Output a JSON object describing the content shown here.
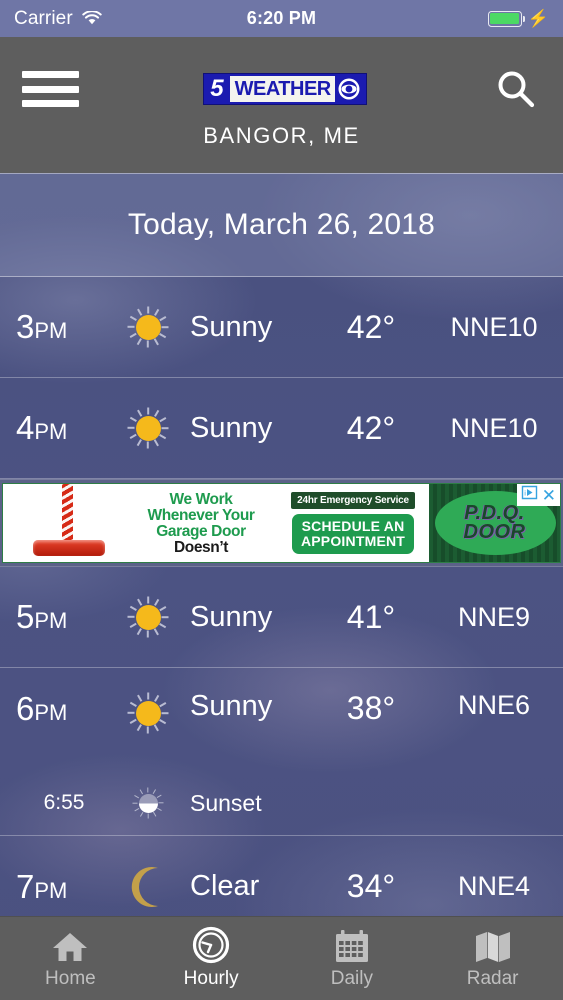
{
  "status_bar": {
    "carrier": "Carrier",
    "time": "6:20 PM",
    "wifi_icon": "wifi-icon",
    "battery_icon": "battery-full-icon",
    "charging_icon": "lightning-bolt-icon"
  },
  "header": {
    "menu_icon": "hamburger-menu-icon",
    "search_icon": "search-icon",
    "logo": {
      "channel": "5",
      "word": "WEATHER",
      "eye_icon": "cbs-eye-icon"
    },
    "city": "BANGOR, ME"
  },
  "date_banner": {
    "text": "Today, March 26, 2018"
  },
  "hourly": [
    {
      "hour": "3",
      "ampm": "PM",
      "icon": "sun-icon",
      "condition": "Sunny",
      "temp": "42°",
      "wind": "NNE10"
    },
    {
      "hour": "4",
      "ampm": "PM",
      "icon": "sun-icon",
      "condition": "Sunny",
      "temp": "42°",
      "wind": "NNE10"
    },
    {
      "hour": "5",
      "ampm": "PM",
      "icon": "sun-icon",
      "condition": "Sunny",
      "temp": "41°",
      "wind": "NNE9"
    },
    {
      "hour": "6",
      "ampm": "PM",
      "icon": "sun-icon",
      "condition": "Sunny",
      "temp": "38°",
      "wind": "NNE6",
      "sub": {
        "time": "6:55",
        "icon": "sunset-icon",
        "label": "Sunset"
      }
    },
    {
      "hour": "7",
      "ampm": "PM",
      "icon": "moon-icon",
      "condition": "Clear",
      "temp": "34°",
      "wind": "NNE4"
    }
  ],
  "ad": {
    "headline_1": "We Work",
    "headline_2": "Whenever Your",
    "headline_3": "Garage Door",
    "headline_4": "Doesn’t",
    "tag": "24hr Emergency Service",
    "cta_line1": "SCHEDULE AN",
    "cta_line2": "APPOINTMENT",
    "brand_line1": "P.D.Q.",
    "brand_line2": "DOOR",
    "adchoices_icon": "adchoices-icon",
    "close_label": "✕"
  },
  "tabbar": [
    {
      "label": "Home",
      "icon": "home-icon",
      "active": false
    },
    {
      "label": "Hourly",
      "icon": "clock-icon",
      "active": true
    },
    {
      "label": "Daily",
      "icon": "calendar-icon",
      "active": false
    },
    {
      "label": "Radar",
      "icon": "map-icon",
      "active": false
    }
  ],
  "colors": {
    "sky": "#4a5180",
    "status_bar": "#6f76a6",
    "chrome_gray": "#5e5e5e",
    "logo_blue": "#1b1bb0",
    "sun_yellow": "#f5b91b",
    "moon_gold": "#c3a04a",
    "battery_green": "#4cd964",
    "ad_green": "#1e9b4e",
    "active_tab": "#ffffff",
    "inactive_tab": "#bfbfbf"
  }
}
